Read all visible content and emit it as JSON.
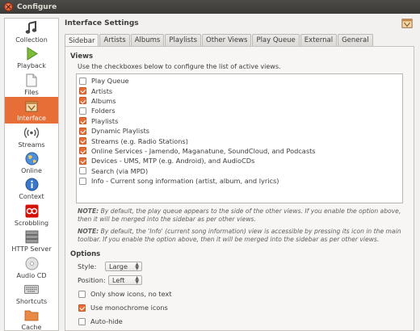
{
  "window": {
    "title": "Configure"
  },
  "sidebar": {
    "items": [
      {
        "label": "Collection",
        "icon": "music-note-icon",
        "active": false
      },
      {
        "label": "Playback",
        "icon": "play-icon",
        "active": false
      },
      {
        "label": "Files",
        "icon": "file-icon",
        "active": false
      },
      {
        "label": "Interface",
        "icon": "interface-icon",
        "active": true
      },
      {
        "label": "Streams",
        "icon": "streams-icon",
        "active": false
      },
      {
        "label": "Online",
        "icon": "globe-icon",
        "active": false
      },
      {
        "label": "Context",
        "icon": "info-icon",
        "active": false
      },
      {
        "label": "Scrobbling",
        "icon": "lastfm-icon",
        "active": false
      },
      {
        "label": "HTTP Server",
        "icon": "server-icon",
        "active": false
      },
      {
        "label": "Audio CD",
        "icon": "cd-icon",
        "active": false
      },
      {
        "label": "Shortcuts",
        "icon": "keyboard-icon",
        "active": false
      },
      {
        "label": "Cache",
        "icon": "folder-icon",
        "active": false
      }
    ]
  },
  "main": {
    "title": "Interface Settings",
    "tabs": [
      {
        "label": "Sidebar",
        "active": true
      },
      {
        "label": "Artists",
        "active": false
      },
      {
        "label": "Albums",
        "active": false
      },
      {
        "label": "Playlists",
        "active": false
      },
      {
        "label": "Other Views",
        "active": false
      },
      {
        "label": "Play Queue",
        "active": false
      },
      {
        "label": "External",
        "active": false
      },
      {
        "label": "General",
        "active": false
      }
    ]
  },
  "views": {
    "heading": "Views",
    "hint": "Use the checkboxes below to configure the list of active views.",
    "items": [
      {
        "label": "Play Queue",
        "checked": false
      },
      {
        "label": "Artists",
        "checked": true
      },
      {
        "label": "Albums",
        "checked": true
      },
      {
        "label": "Folders",
        "checked": false
      },
      {
        "label": "Playlists",
        "checked": true
      },
      {
        "label": "Dynamic Playlists",
        "checked": true
      },
      {
        "label": "Streams (e.g. Radio Stations)",
        "checked": true
      },
      {
        "label": "Online Services - Jamendo, Maganatune, SoundCloud, and Podcasts",
        "checked": true
      },
      {
        "label": "Devices - UMS, MTP (e.g. Android), and AudioCDs",
        "checked": true
      },
      {
        "label": "Search (via MPD)",
        "checked": false
      },
      {
        "label": "Info - Current song information (artist, album, and lyrics)",
        "checked": false
      }
    ],
    "note1_prefix": "NOTE:",
    "note1_text": "By default, the play queue appears to the side of the other views. If you enable the option above, then it will be merged into the sidebar as per other views.",
    "note2_prefix": "NOTE:",
    "note2_text": "By default, the 'Info' (current song information) view is accessible by pressing its icon in the main toolbar. If you enable the option above, then it will be merged into the sidebar as per other views."
  },
  "options": {
    "heading": "Options",
    "style_label": "Style:",
    "style_value": "Large",
    "position_label": "Position:",
    "position_value": "Left",
    "only_icons_label": "Only show icons, no text",
    "only_icons_checked": false,
    "monochrome_label": "Use monochrome icons",
    "monochrome_checked": true,
    "autohide_label": "Auto-hide",
    "autohide_checked": false
  },
  "colors": {
    "accent": "#e86e37",
    "titlebar": "#3c3b37"
  }
}
